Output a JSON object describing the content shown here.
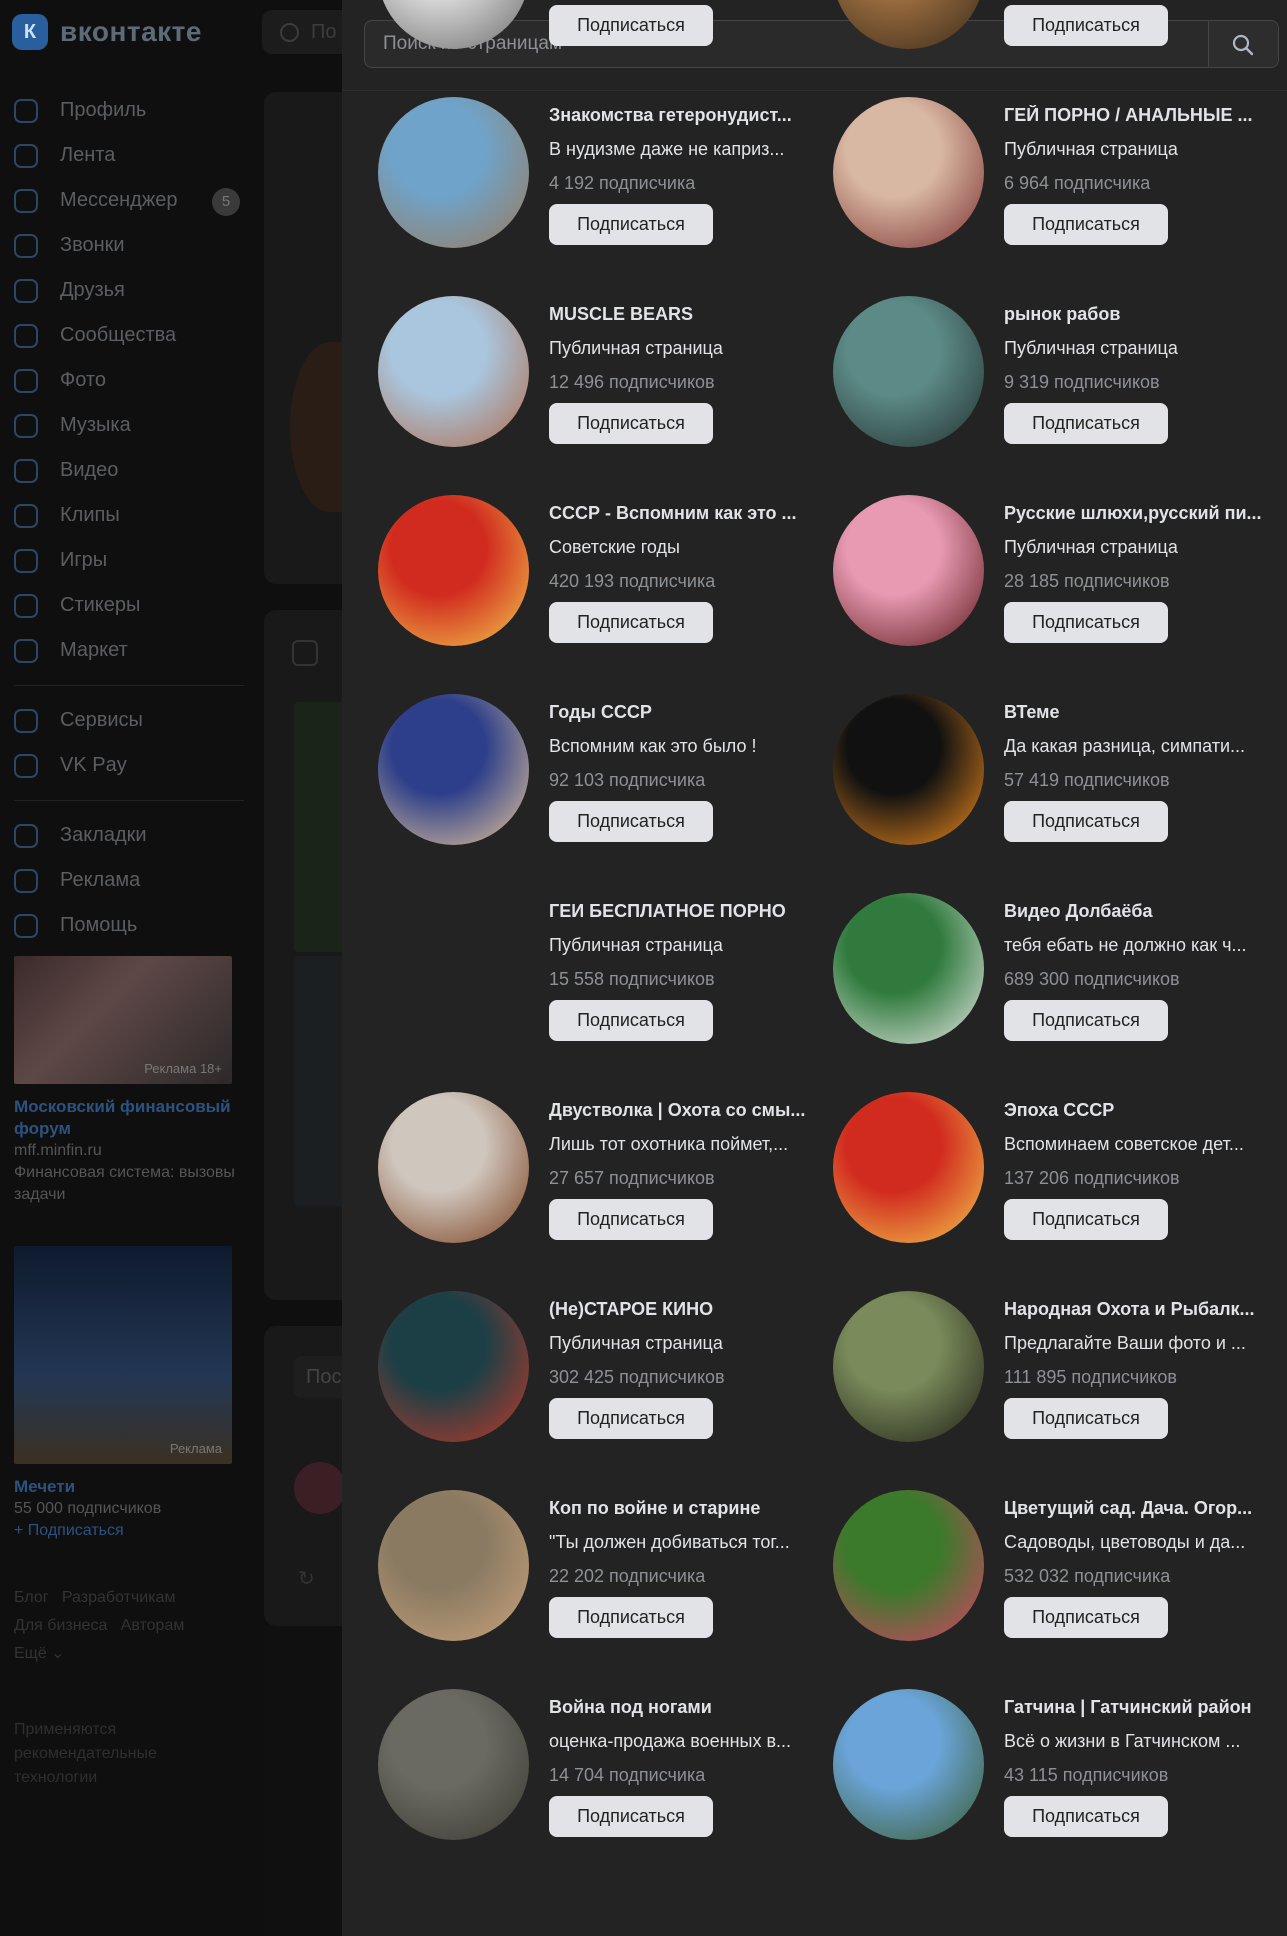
{
  "background": {
    "logo_mark": "К",
    "logo_text": "вконтакте",
    "search_placeholder": "По",
    "nav": [
      {
        "label": "Профиль",
        "icon": "profile-icon"
      },
      {
        "label": "Лента",
        "icon": "feed-icon"
      },
      {
        "label": "Мессенджер",
        "icon": "messenger-icon",
        "badge": "5"
      },
      {
        "label": "Звонки",
        "icon": "phone-icon"
      },
      {
        "label": "Друзья",
        "icon": "friends-icon"
      },
      {
        "label": "Сообщества",
        "icon": "communities-icon"
      },
      {
        "label": "Фото",
        "icon": "photo-icon"
      },
      {
        "label": "Музыка",
        "icon": "music-icon"
      },
      {
        "label": "Видео",
        "icon": "video-icon"
      },
      {
        "label": "Клипы",
        "icon": "clips-icon"
      },
      {
        "label": "Игры",
        "icon": "games-icon"
      },
      {
        "label": "Стикеры",
        "icon": "stickers-icon"
      },
      {
        "label": "Маркет",
        "icon": "market-icon"
      }
    ],
    "nav2": [
      {
        "label": "Сервисы",
        "icon": "services-icon"
      },
      {
        "label": "VK Pay",
        "icon": "vkpay-icon"
      }
    ],
    "nav3": [
      {
        "label": "Закладки",
        "icon": "bookmark-icon"
      },
      {
        "label": "Реклама",
        "icon": "ads-icon"
      },
      {
        "label": "Помощь",
        "icon": "help-icon"
      }
    ],
    "ad1": {
      "tag": "Реклама 18+",
      "title": "Московский финансовый форум",
      "url": "mff.minfin.ru",
      "text": "Финансовая система: вызовы задачи"
    },
    "ad2": {
      "tag": "Реклама",
      "title": "Мечети",
      "subscribers": "55 000 подписчиков",
      "follow": "+ Подписаться"
    },
    "footer": {
      "line1": "Блог   Разработчикам",
      "line2": "Для бизнеса   Авторам",
      "line3": "Ещё ⌄",
      "note": "Применяются рекомендательные технологии"
    },
    "post_placeholder": "Пос"
  },
  "panel": {
    "search": {
      "placeholder": "Поиск по страницам"
    },
    "subscribe_label": "Подписаться",
    "groups": [
      {
        "name": "",
        "desc": "",
        "count": "",
        "colors": [
          "#d8d8d8",
          "#6b6b6b"
        ]
      },
      {
        "name": "",
        "desc": "",
        "count": "",
        "colors": [
          "#9a6d3f",
          "#3a2a1a"
        ]
      },
      {
        "name": "Знакомства гетеронудист...",
        "desc": "В нудизме даже не каприз...",
        "count": "4 192 подписчика",
        "colors": [
          "#6fa3c9",
          "#9a7a5a"
        ]
      },
      {
        "name": "ГЕЙ ПОРНО / АНАЛЬНЫЕ ...",
        "desc": "Публичная страница",
        "count": "6 964 подписчика",
        "colors": [
          "#d9b8a3",
          "#7a2f2f"
        ]
      },
      {
        "name": "MUSCLE BEARS",
        "desc": "Публичная страница",
        "count": "12 496 подписчиков",
        "colors": [
          "#a9c6de",
          "#b06b4a"
        ]
      },
      {
        "name": "рынок рабов",
        "desc": "Публичная страница",
        "count": "9 319 подписчиков",
        "colors": [
          "#5c8a86",
          "#23302f"
        ]
      },
      {
        "name": "СССР - Вспомним как это ...",
        "desc": "Советские годы",
        "count": "420 193 подписчика",
        "colors": [
          "#d12a1f",
          "#f2c94c"
        ]
      },
      {
        "name": "Русские шлюхи,русский пи...",
        "desc": "Публичная страница",
        "count": "28 185 подписчиков",
        "colors": [
          "#e89ab3",
          "#5a1818"
        ]
      },
      {
        "name": "Годы СССР",
        "desc": "Вспомним как это было !",
        "count": "92 103 подписчика",
        "colors": [
          "#2d3f8a",
          "#e8c79a"
        ]
      },
      {
        "name": "ВТеме",
        "desc": "Да какая разница, симпати...",
        "count": "57 419 подписчиков",
        "colors": [
          "#111111",
          "#f28c1c"
        ]
      },
      {
        "name": "ГЕИ БЕСПЛАТНОЕ ПОРНО",
        "desc": "Публичная страница",
        "count": "15 558 подписчиков",
        "colors": [
          "#232323",
          "#232323"
        ]
      },
      {
        "name": "Видео Долбаёба",
        "desc": "тебя ебать не должно как ч...",
        "count": "689 300 подписчиков",
        "colors": [
          "#2f7a3c",
          "#e8e8e8"
        ]
      },
      {
        "name": "Двустволка | Охота со смы...",
        "desc": "Лишь тот охотника поймет,...",
        "count": "27 657 подписчиков",
        "colors": [
          "#cfc6bd",
          "#7a3e1c"
        ]
      },
      {
        "name": "Эпоха СССР",
        "desc": "Вспоминаем советское дет...",
        "count": "137 206 подписчиков",
        "colors": [
          "#d12a1f",
          "#f2c94c"
        ]
      },
      {
        "name": "(Не)СТАРОЕ КИНО",
        "desc": "Публичная страница",
        "count": "302 425 подписчиков",
        "colors": [
          "#1c3f45",
          "#c23a2a"
        ]
      },
      {
        "name": "Народная Охота и Рыбалк...",
        "desc": "Предлагайте Ваши фото и ...",
        "count": "111 895 подписчиков",
        "colors": [
          "#7a8a5a",
          "#1e1e16"
        ]
      },
      {
        "name": "Коп по войне и старине",
        "desc": "\"Ты должен добиваться тог...",
        "count": "22 202 подписчика",
        "colors": [
          "#8a7a62",
          "#c9a27a"
        ]
      },
      {
        "name": "Цветущий сад. Дача. Огор...",
        "desc": "Садоводы, цветоводы и да...",
        "count": "532 032 подписчика",
        "colors": [
          "#3a7a2a",
          "#d8416a"
        ]
      },
      {
        "name": "Война под ногами",
        "desc": "оценка-продажа военных в...",
        "count": "14 704 подписчика",
        "colors": [
          "#6a6a62",
          "#3a3a32"
        ]
      },
      {
        "name": "Гатчина | Гатчинский район",
        "desc": "Всё о жизни в Гатчинском ...",
        "count": "43 115 подписчиков",
        "colors": [
          "#6aa4d8",
          "#3a5a2a"
        ]
      }
    ]
  }
}
